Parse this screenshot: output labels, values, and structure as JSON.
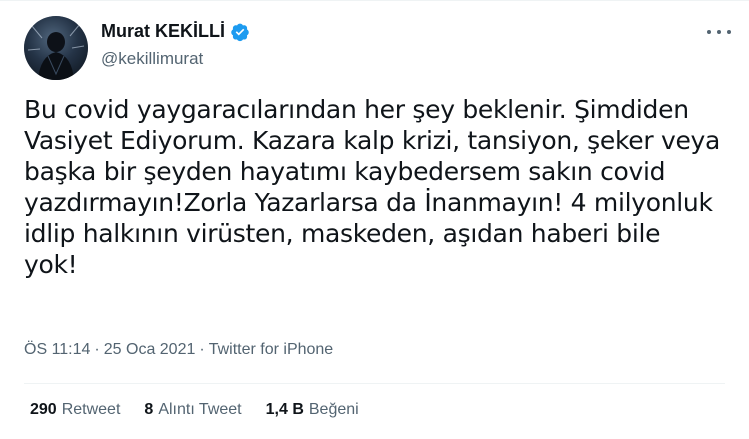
{
  "author": {
    "display_name": "Murat KEKİLLİ",
    "handle": "@kekillimurat",
    "verified": true
  },
  "tweet": {
    "text": "Bu covid yaygaracılarından her şey beklenir. Şimdiden\nVasiyet Ediyorum. Kazara kalp krizi, tansiyon, şeker veya\nbaşka bir şeyden hayatımı kaybedersem sakın covid\nyazdırmayın!Zorla Yazarlarsa da İnanmayın! 4 milyonluk\nidlip halkının virüsten, maskeden, aşıdan haberi bile\nyok!",
    "time": "ÖS 11:14",
    "separator": "·",
    "date": "25 Oca 2021",
    "source": "Twitter for iPhone"
  },
  "stats": {
    "retweets_count": "290",
    "retweets_label": "Retweet",
    "quotes_count": "8",
    "quotes_label": "Alıntı Tweet",
    "likes_count": "1,4 B",
    "likes_label": "Beğeni"
  },
  "colors": {
    "verified": "#1d9bf0",
    "secondary_text": "#536471",
    "primary_text": "#0f1419"
  },
  "icons": [
    "verified-badge-icon",
    "more-options-icon"
  ]
}
